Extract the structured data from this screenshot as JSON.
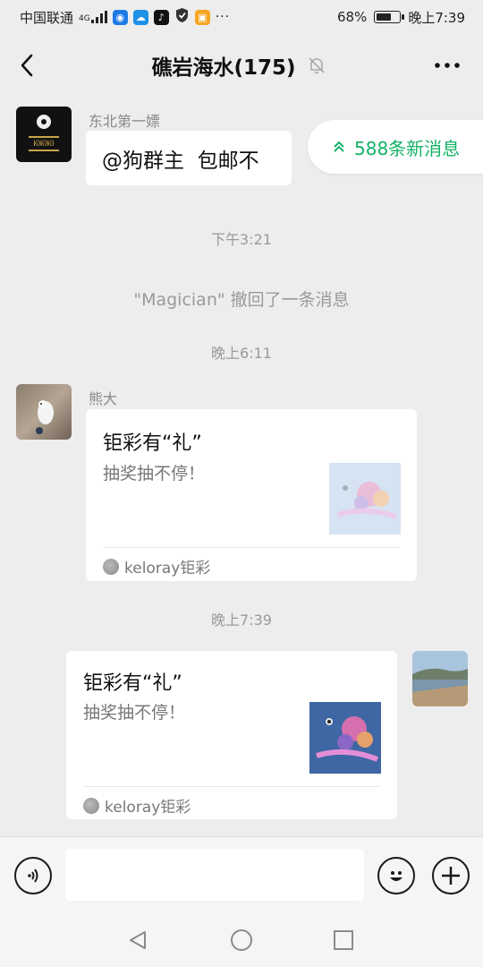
{
  "status_bar": {
    "carrier": "中国联通",
    "network": "4G",
    "battery": "68%",
    "battery_level": 0.68,
    "time": "晚上7:39"
  },
  "header": {
    "title": "礁岩海水(175)",
    "icons": [
      "back-arrow-icon",
      "mute-bell-icon",
      "more-icon"
    ]
  },
  "new_messages": {
    "label": "588条新消息"
  },
  "messages": [
    {
      "type": "text",
      "sender": "东北第一嫖",
      "text": "@狗群主  包邮不"
    },
    {
      "type": "time",
      "text": "下午3:21"
    },
    {
      "type": "system",
      "text": "\"Magician\" 撤回了一条消息"
    },
    {
      "type": "time",
      "text": "晚上6:11"
    },
    {
      "type": "card",
      "sender": "熊大",
      "title": "钜彩有“礼”",
      "desc": "抽奖抽不停！",
      "source": "keloray钜彩"
    },
    {
      "type": "time",
      "text": "晚上7:39"
    },
    {
      "type": "card",
      "sender": "",
      "title": "钜彩有“礼”",
      "desc": "抽奖抽不停！",
      "source": "keloray钜彩"
    }
  ],
  "input_bar": {
    "placeholder": "",
    "icons": [
      "voice-icon",
      "emoji-icon",
      "plus-icon"
    ]
  },
  "colors": {
    "accent_green": "#13b266",
    "background": "#ededed"
  }
}
